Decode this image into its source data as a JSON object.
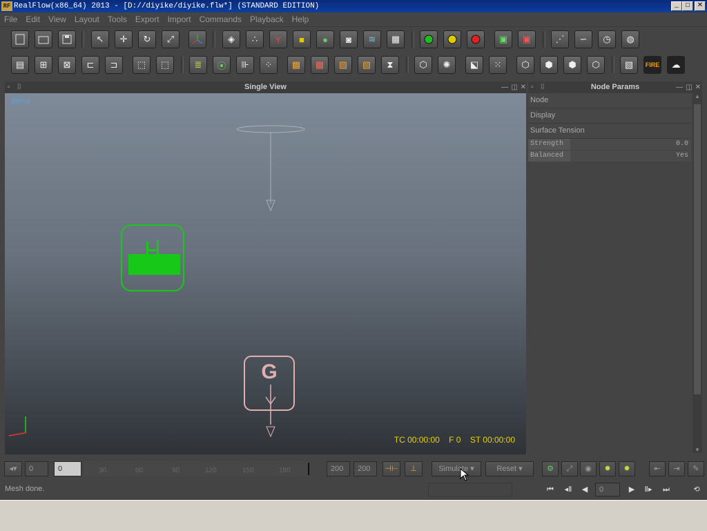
{
  "window": {
    "title": "RealFlow(x86_64) 2013 - [D://diyike/diyike.flw*] (STANDARD EDITION)",
    "app_icon_text": "RF",
    "minimize_glyph": "_",
    "maximize_glyph": "□",
    "close_glyph": "✕"
  },
  "menu": [
    "File",
    "Edit",
    "View",
    "Layout",
    "Tools",
    "Export",
    "Import",
    "Commands",
    "Playback",
    "Help"
  ],
  "toolbar_icons": {
    "row1": [
      "new-file-icon",
      "open-file-icon",
      "save-file-icon",
      "select-arrow-icon",
      "move-icon",
      "rotate-icon",
      "scale-icon",
      "axis-gizmo-icon",
      "plane-icon",
      "particles-icon",
      "daemon-icon",
      "cube-icon",
      "mesh-icon",
      "camera-icon",
      "wave-icon",
      "grid-box-icon",
      "green-record-icon",
      "yellow-record-icon",
      "red-record-icon",
      "export-green-icon",
      "export-red-icon",
      "simulate-node-icon",
      "batch-icon",
      "clock-icon",
      "render-icon"
    ],
    "row2": [
      "node-list-icon",
      "add-node-icon",
      "remove-node-icon",
      "link-node-icon",
      "unlink-node-icon",
      "box-emitter-icon",
      "box-emitter-2-icon",
      "script-icon",
      "chain-icon",
      "ruler-icon",
      "spheres-icon",
      "fracture-1-icon",
      "fracture-2-icon",
      "fracture-3-icon",
      "fracture-4-icon",
      "hourglass-icon",
      "sphere-wire-icon",
      "sphere-dots-icon",
      "box-wire-icon",
      "box-dots-icon",
      "cube-a-icon",
      "cube-b-icon",
      "cube-c-icon",
      "cube-d-icon",
      "film-icon",
      "fire-icon",
      "smoke-icon"
    ]
  },
  "fire_label": "FIRE",
  "viewport": {
    "panel_title": "Single View",
    "camera_label": "persp",
    "hud": {
      "tc": "TC 00:00:00",
      "frame": "F 0",
      "st": "ST 00:00:00"
    },
    "gravity_label": "G"
  },
  "node_params": {
    "panel_title": "Node Params",
    "sections": [
      "Node",
      "Display",
      "Surface Tension"
    ],
    "fields": [
      {
        "label": "Strength",
        "value": "0.0"
      },
      {
        "label": "Balanced",
        "value": "Yes"
      }
    ]
  },
  "timeline": {
    "current_frame": "0",
    "start_frame": "0",
    "ticks": [
      "30",
      "60",
      "90",
      "120",
      "150",
      "180"
    ],
    "end_frame": "200",
    "end_frame2": "200",
    "simulate_label": "Simulate",
    "reset_label": "Reset"
  },
  "status": {
    "message": "Mesh done.",
    "playback_frame": "0"
  },
  "colors": {
    "accent_green": "#18c818",
    "gravity_pink": "#e0b0b0",
    "hud_yellow": "#e8d200"
  }
}
